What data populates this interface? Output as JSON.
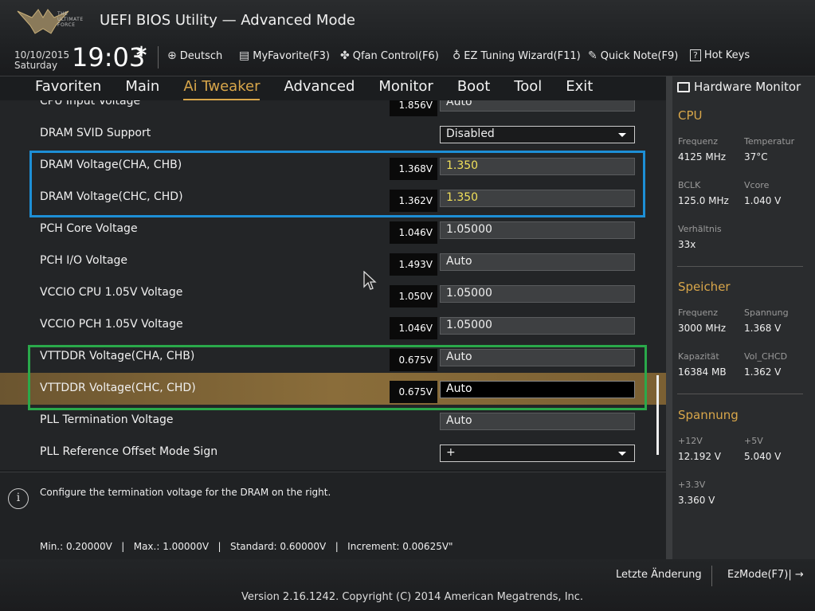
{
  "header": {
    "logo_text": "THE ULTIMATE FORCE",
    "title": "UEFI BIOS Utility — Advanced Mode",
    "date": "10/10/2015",
    "weekday": "Saturday",
    "time": "19:03"
  },
  "toolbar": {
    "language": "Deutsch",
    "myfavorite": "MyFavorite(F3)",
    "qfan": "Qfan Control(F6)",
    "ez_tuning": "EZ Tuning Wizard(F11)",
    "quick_note": "Quick Note(F9)",
    "hot_keys": "Hot Keys"
  },
  "tabs": [
    "Favoriten",
    "Main",
    "Ai Tweaker",
    "Advanced",
    "Monitor",
    "Boot",
    "Tool",
    "Exit"
  ],
  "active_tab": "Ai Tweaker",
  "settings": [
    {
      "label": "CPU Input Voltage",
      "measured": "1.856V",
      "value": "Auto",
      "kind": "field"
    },
    {
      "label": "DRAM SVID Support",
      "measured": "",
      "value": "Disabled",
      "kind": "dropdown"
    },
    {
      "label": "DRAM Voltage(CHA, CHB)",
      "measured": "1.368V",
      "value": "1.350",
      "kind": "field-yellow"
    },
    {
      "label": "DRAM Voltage(CHC, CHD)",
      "measured": "1.362V",
      "value": "1.350",
      "kind": "field-yellow"
    },
    {
      "label": "PCH Core Voltage",
      "measured": "1.046V",
      "value": "1.05000",
      "kind": "field"
    },
    {
      "label": "PCH I/O Voltage",
      "measured": "1.493V",
      "value": "Auto",
      "kind": "field"
    },
    {
      "label": "VCCIO CPU 1.05V Voltage",
      "measured": "1.050V",
      "value": "1.05000",
      "kind": "field"
    },
    {
      "label": "VCCIO PCH 1.05V Voltage",
      "measured": "1.046V",
      "value": "1.05000",
      "kind": "field"
    },
    {
      "label": "VTTDDR Voltage(CHA, CHB)",
      "measured": "0.675V",
      "value": "Auto",
      "kind": "field"
    },
    {
      "label": "VTTDDR Voltage(CHC, CHD)",
      "measured": "0.675V",
      "value": "Auto",
      "kind": "field-selected"
    },
    {
      "label": "PLL Termination Voltage",
      "measured": "",
      "value": "Auto",
      "kind": "field"
    },
    {
      "label": "PLL Reference Offset Mode Sign",
      "measured": "",
      "value": "+",
      "kind": "dropdown"
    }
  ],
  "help": {
    "description": "Configure the termination voltage for the DRAM on the right.",
    "limits": "Min.: 0.20000V   |   Max.: 1.00000V   |   Standard: 0.60000V   |   Increment: 0.00625V\""
  },
  "hw_monitor": {
    "title": "Hardware Monitor",
    "cpu": {
      "heading": "CPU",
      "freq_label": "Frequenz",
      "freq": "4125 MHz",
      "temp_label": "Temperatur",
      "temp": "37°C",
      "bclk_label": "BCLK",
      "bclk": "125.0 MHz",
      "vcore_label": "Vcore",
      "vcore": "1.040 V",
      "ratio_label": "Verhältnis",
      "ratio": "33x"
    },
    "memory": {
      "heading": "Speicher",
      "freq_label": "Frequenz",
      "freq": "3000 MHz",
      "volt_label": "Spannung",
      "volt": "1.368 V",
      "cap_label": "Kapazität",
      "cap": "16384 MB",
      "chcd_label": "Vol_CHCD",
      "chcd": "1.362 V"
    },
    "voltage": {
      "heading": "Spannung",
      "v12_label": "+12V",
      "v12": "12.192 V",
      "v5_label": "+5V",
      "v5": "5.040 V",
      "v33_label": "+3.3V",
      "v33": "3.360 V"
    }
  },
  "footer": {
    "last_change": "Letzte Änderung",
    "ezmode": "EzMode(F7)|",
    "copyright": "Version 2.16.1242. Copyright (C) 2014 American Megatrends, Inc."
  },
  "colors": {
    "accent": "#d8a64a",
    "highlight_blue": "#1d8fd6",
    "highlight_green": "#2aa94a",
    "yellow_value": "#f1e05a"
  }
}
